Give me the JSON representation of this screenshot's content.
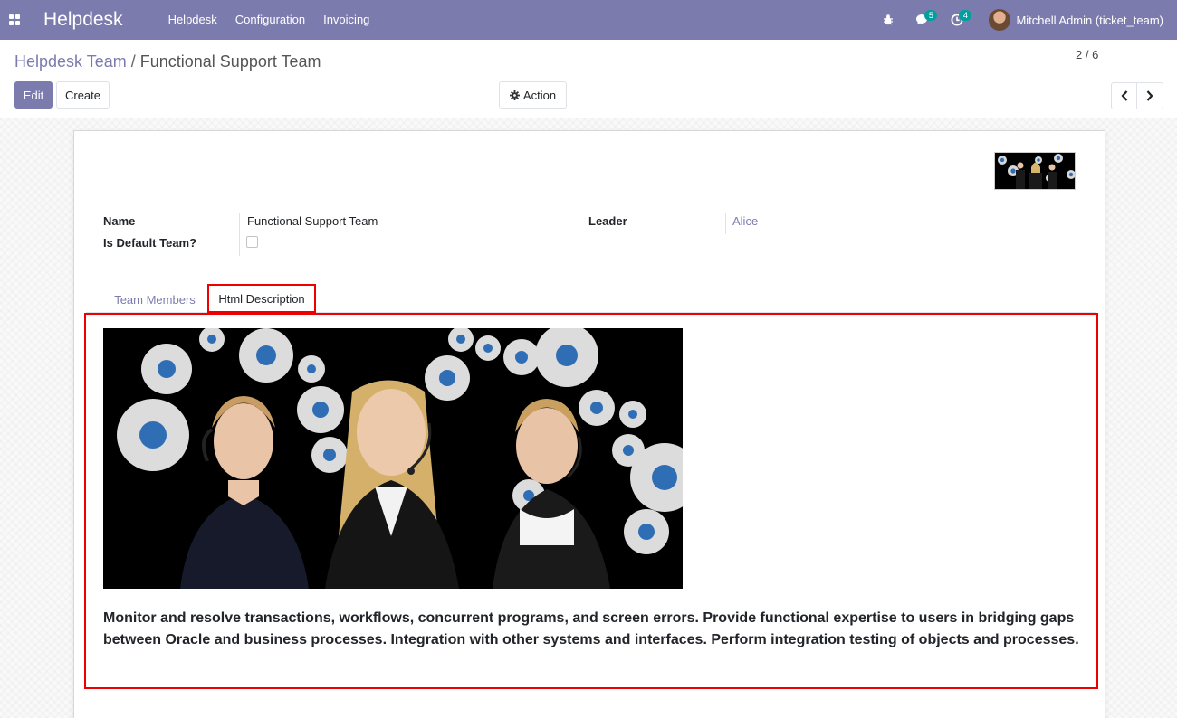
{
  "navbar": {
    "brand": "Helpdesk",
    "menu": [
      "Helpdesk",
      "Configuration",
      "Invoicing"
    ],
    "messages_count": "5",
    "activities_count": "4",
    "user_name": "Mitchell Admin (ticket_team)"
  },
  "breadcrumb": {
    "parent": "Helpdesk Team",
    "separator": "/",
    "current": "Functional Support Team"
  },
  "buttons": {
    "edit": "Edit",
    "create": "Create",
    "action": "Action"
  },
  "pager": {
    "value": "2 / 6"
  },
  "form": {
    "name_label": "Name",
    "name_value": "Functional Support Team",
    "default_label": "Is Default Team?",
    "default_checked": false,
    "leader_label": "Leader",
    "leader_value": "Alice"
  },
  "tabs": [
    {
      "label": "Team Members",
      "active": false
    },
    {
      "label": "Html Description",
      "active": true
    }
  ],
  "description": "Monitor and resolve transactions, workflows, concurrent programs, and screen errors. Provide functional expertise to users in bridging gaps between Oracle and business processes. Integration with other systems and interfaces. Perform integration testing of objects and processes.",
  "colors": {
    "brand": "#7c7bad",
    "badge": "#00a09d",
    "highlight": "#ee0000"
  }
}
